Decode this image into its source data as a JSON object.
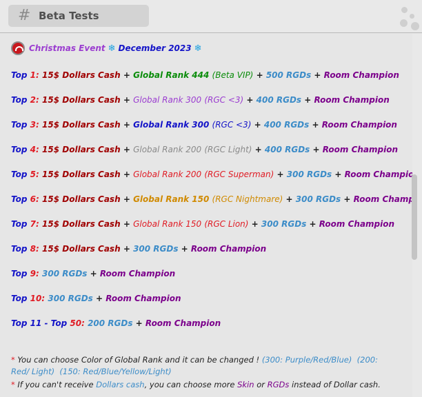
{
  "header": {
    "channel_icon": "hash-icon",
    "channel_name": "Beta Tests"
  },
  "event": {
    "title": "Christmas Event",
    "month": "December 2023",
    "snow_glyph": "❄"
  },
  "rows": [
    {
      "label": "Top",
      "num": "1",
      "cash": "15$ Dollars Cash",
      "rank": "Global Rank 444",
      "rank_note": "(Beta VIP)",
      "rgds": "500 RGDs",
      "extra": "Room Champion"
    },
    {
      "label": "Top",
      "num": "2",
      "cash": "15$ Dollars Cash",
      "rank": "Global Rank 300",
      "rank_note": "(RGC <3)",
      "rgds": "400 RGDs",
      "extra": "Room Champion"
    },
    {
      "label": "Top",
      "num": "3",
      "cash": "15$ Dollars Cash",
      "rank": "Global Rank 300",
      "rank_note": "(RGC <3)",
      "rgds": "400 RGDs",
      "extra": "Room Champion"
    },
    {
      "label": "Top",
      "num": "4",
      "cash": "15$ Dollars Cash",
      "rank": "Global Rank 200",
      "rank_note": "(RGC Light)",
      "rgds": "400 RGDs",
      "extra": "Room Champion"
    },
    {
      "label": "Top",
      "num": "5",
      "cash": "15$ Dollars Cash",
      "rank": "Global Rank 200",
      "rank_note": "(RGC Superman)",
      "rgds": "300 RGDs",
      "extra": "Room Champion"
    },
    {
      "label": "Top",
      "num": "6",
      "cash": "15$ Dollars Cash",
      "rank": "Global Rank 150",
      "rank_note": "(RGC Nightmare)",
      "rgds": "300 RGDs",
      "extra": "Room Champion"
    },
    {
      "label": "Top",
      "num": "7",
      "cash": "15$ Dollars Cash",
      "rank": "Global Rank 150",
      "rank_note": "(RGC Lion)",
      "rgds": "300 RGDs",
      "extra": "Room Champion"
    },
    {
      "label": "Top",
      "num": "8",
      "cash": "15$ Dollars Cash",
      "rgds": "300 RGDs",
      "extra": "Room Champion"
    },
    {
      "label": "Top",
      "num": "9",
      "rgds": "300 RGDs",
      "extra": "Room Champion"
    },
    {
      "label": "Top",
      "num": "10",
      "rgds": "300 RGDs",
      "extra": "Room Champion"
    },
    {
      "label": "Top 11 - Top",
      "num": "50",
      "rgds": "200 RGDs",
      "extra": "Room Champion"
    }
  ],
  "notes": {
    "note1_text": "You can choose Color of Global Rank and it can be changed !",
    "note1_colors_a": "(300: Purple/Red/Blue)",
    "note1_colors_b": "(200: Red/",
    "note1_colors_c": "Light)",
    "note1_colors_d": "(150: Red/Blue/Yellow/Light)",
    "note2_a": "If you can't receive",
    "note2_b": "Dollars cash",
    "note2_c": ", you can choose more",
    "note2_d": "Skin",
    "note2_e": "or",
    "note2_f": "RGDs",
    "note2_g": "instead of Dollar cash."
  }
}
